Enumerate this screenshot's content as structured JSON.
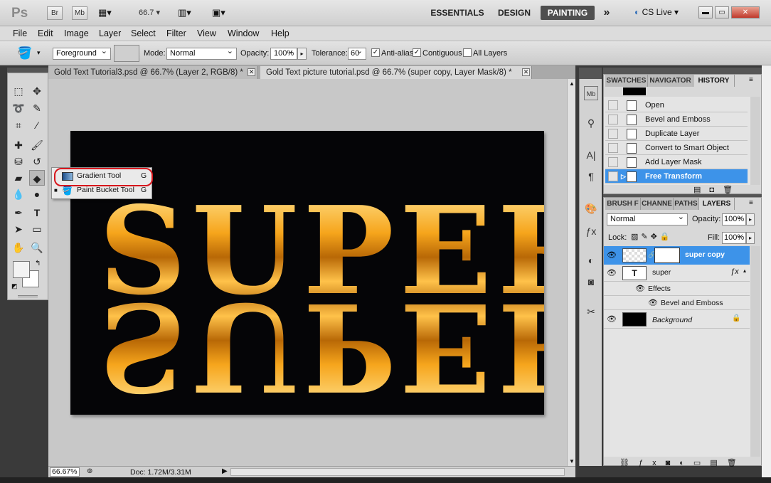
{
  "app": {
    "logo": "Ps",
    "zoom": "66.7",
    "bridge_label": "Br",
    "minibridge_label": "Mb"
  },
  "workspaces": {
    "essentials": "ESSENTIALS",
    "design": "DESIGN",
    "painting": "PAINTING",
    "more": "»",
    "cs_live": "CS Live"
  },
  "menu": [
    "File",
    "Edit",
    "Image",
    "Layer",
    "Select",
    "Filter",
    "View",
    "Window",
    "Help"
  ],
  "options": {
    "fill_source": "Foreground",
    "mode_label": "Mode:",
    "mode_value": "Normal",
    "opacity_label": "Opacity:",
    "opacity_value": "100%",
    "tolerance_label": "Tolerance:",
    "tolerance_value": "60",
    "antialias_label": "Anti-alias",
    "antialias_checked": true,
    "contiguous_label": "Contiguous",
    "contiguous_checked": true,
    "all_layers_label": "All Layers",
    "all_layers_checked": false
  },
  "doc_tabs": [
    {
      "label": "Gold Text Tutorial3.psd @ 66.7% (Layer 2, RGB/8) *",
      "active": false
    },
    {
      "label": "Gold Text picture tutorial.psd @ 66.7% (super copy, Layer Mask/8) *",
      "active": true
    }
  ],
  "canvas": {
    "text": "SUPER",
    "background_color": "#050507",
    "gold_color": "#f2a01c"
  },
  "flyout": {
    "items": [
      {
        "label": "Gradient Tool",
        "shortcut": "G",
        "current": false
      },
      {
        "label": "Paint Bucket Tool",
        "shortcut": "G",
        "current": true
      }
    ]
  },
  "history_panel": {
    "tabs": [
      "SWATCHES",
      "NAVIGATOR",
      "HISTORY"
    ],
    "items": [
      "Open",
      "Bevel and Emboss",
      "Duplicate Layer",
      "Convert to Smart Object",
      "Add Layer Mask",
      "Free Transform"
    ],
    "selected_index": 5
  },
  "layers_panel": {
    "tabs": [
      "BRUSH F",
      "CHANNE",
      "PATHS",
      "LAYERS"
    ],
    "blend_mode": "Normal",
    "opacity_label": "Opacity:",
    "opacity_value": "100%",
    "lock_label": "Lock:",
    "fill_label": "Fill:",
    "fill_value": "100%",
    "layers": [
      {
        "name": "super copy",
        "selected": true
      },
      {
        "name": "super",
        "type_layer": true,
        "effects_label": "Effects",
        "effect": "Bevel and Emboss"
      },
      {
        "name": "Background",
        "locked": true
      }
    ]
  },
  "status": {
    "zoom": "66.67%",
    "doc": "Doc: 1.72M/3.31M"
  },
  "colors": {
    "accent": "#3d93e9",
    "highlight_circle": "#d7161c"
  }
}
